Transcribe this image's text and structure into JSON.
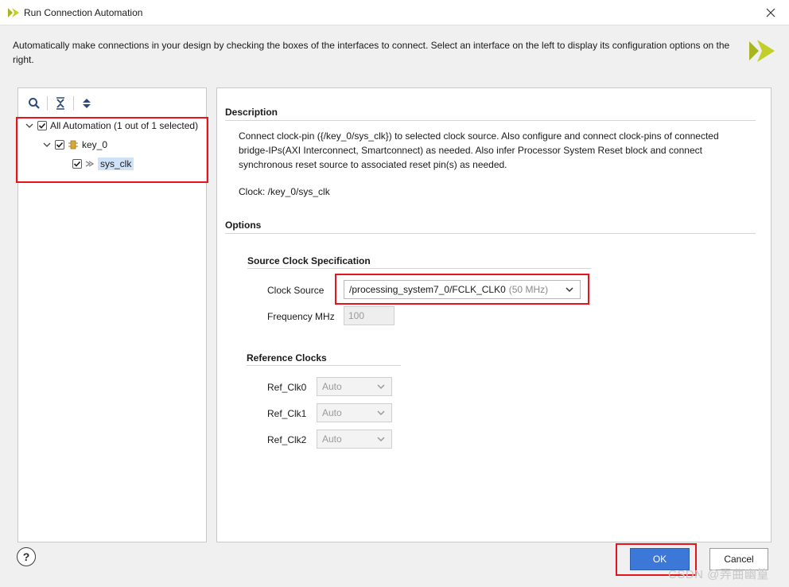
{
  "window": {
    "title": "Run Connection Automation"
  },
  "intro": "Automatically make connections in your design by checking the boxes of the interfaces to connect. Select an interface on the left to display its configuration options on the right.",
  "tree": {
    "root_label": "All Automation (1 out of 1 selected)",
    "child_label": "key_0",
    "leaf_label": "sys_clk"
  },
  "description": {
    "title": "Description",
    "text": "Connect clock-pin ({/key_0/sys_clk}) to selected clock source. Also configure and connect clock-pins of connected bridge-IPs(AXI Interconnect, Smartconnect) as needed. Also infer Processor System Reset block and connect synchronous reset source to associated reset pin(s) as needed.",
    "clock": "Clock: /key_0/sys_clk"
  },
  "options": {
    "title": "Options",
    "source_spec_title": "Source Clock Specification",
    "clock_source_label": "Clock Source",
    "clock_source_value": "/processing_system7_0/FCLK_CLK0",
    "clock_source_freq": "(50 MHz)",
    "frequency_label": "Frequency MHz",
    "frequency_value": "100",
    "ref_clocks_title": "Reference Clocks",
    "ref_clocks": [
      {
        "label": "Ref_Clk0",
        "value": "Auto"
      },
      {
        "label": "Ref_Clk1",
        "value": "Auto"
      },
      {
        "label": "Ref_Clk2",
        "value": "Auto"
      }
    ]
  },
  "buttons": {
    "help": "?",
    "ok": "OK",
    "cancel": "Cancel"
  },
  "watermark": "CSDN @弄曲幽篁",
  "colors": {
    "accent": "#3c78d8",
    "highlight": "#e8141b",
    "logo": "#a7b51e"
  }
}
